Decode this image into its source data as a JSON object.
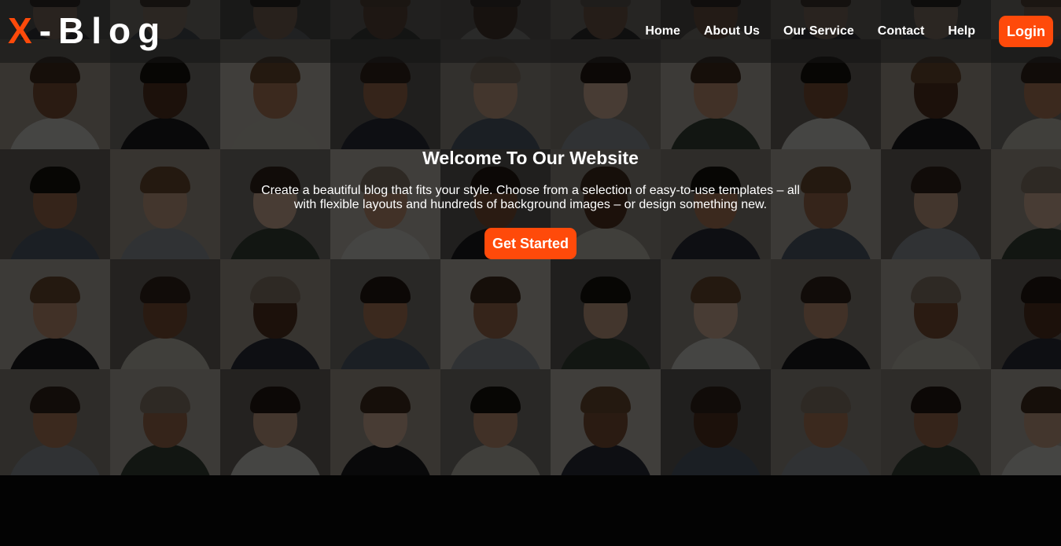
{
  "brand": {
    "logo_accent": "X",
    "logo_rest": "-Blog",
    "accent_color": "#ff4a0a"
  },
  "nav": {
    "links": [
      "Home",
      "About Us",
      "Our Service",
      "Contact",
      "Help"
    ],
    "login_label": "Login"
  },
  "hero": {
    "title": "Welcome To Our Website",
    "description": "Create a beautiful blog that fits your style. Choose from a selection of easy-to-use templates – all with flexible layouts and hundreds of background images – or design something new.",
    "cta_label": "Get Started",
    "background": "grid of portrait photos of smiling people"
  }
}
